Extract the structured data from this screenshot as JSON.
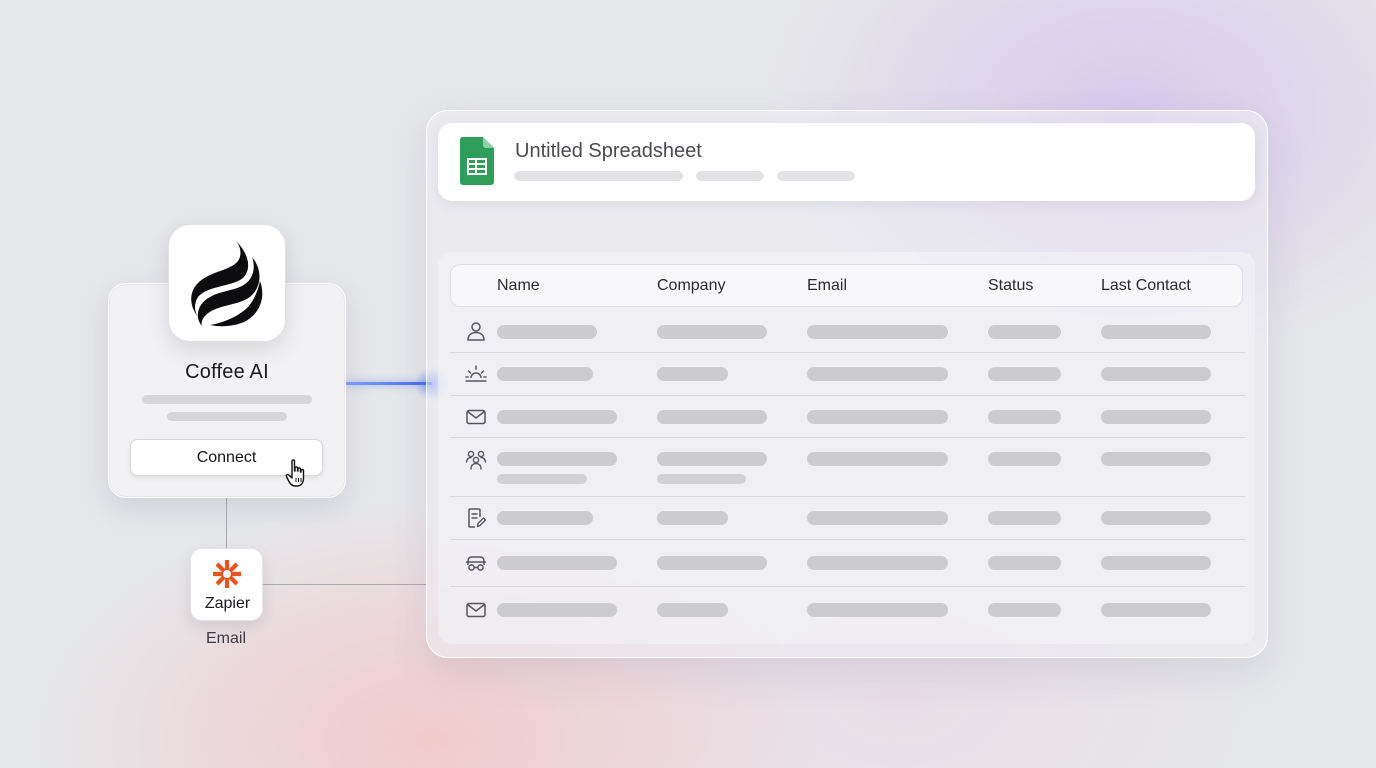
{
  "coffee": {
    "title": "Coffee AI",
    "connect_label": "Connect",
    "logo_icon": "coffee-flame-logo",
    "cursor_icon": "hand-pointer"
  },
  "zapier": {
    "label": "Zapier",
    "sublabel": "Email",
    "brand_color": "#e8531e"
  },
  "sheet": {
    "title": "Untitled Spreadsheet",
    "icon": "google-sheets-icon",
    "brand_color": "#2f9e5b",
    "columns": [
      "Name",
      "Company",
      "Email",
      "Status",
      "Last Contact"
    ],
    "row_icons": [
      "person-icon",
      "sunrise-icon",
      "mail-icon",
      "group-icon",
      "note-edit-icon",
      "car-icon",
      "mail-icon"
    ]
  },
  "colors": {
    "connector_blue": "#3e6cf2",
    "placeholder": "#cbcbd0"
  }
}
